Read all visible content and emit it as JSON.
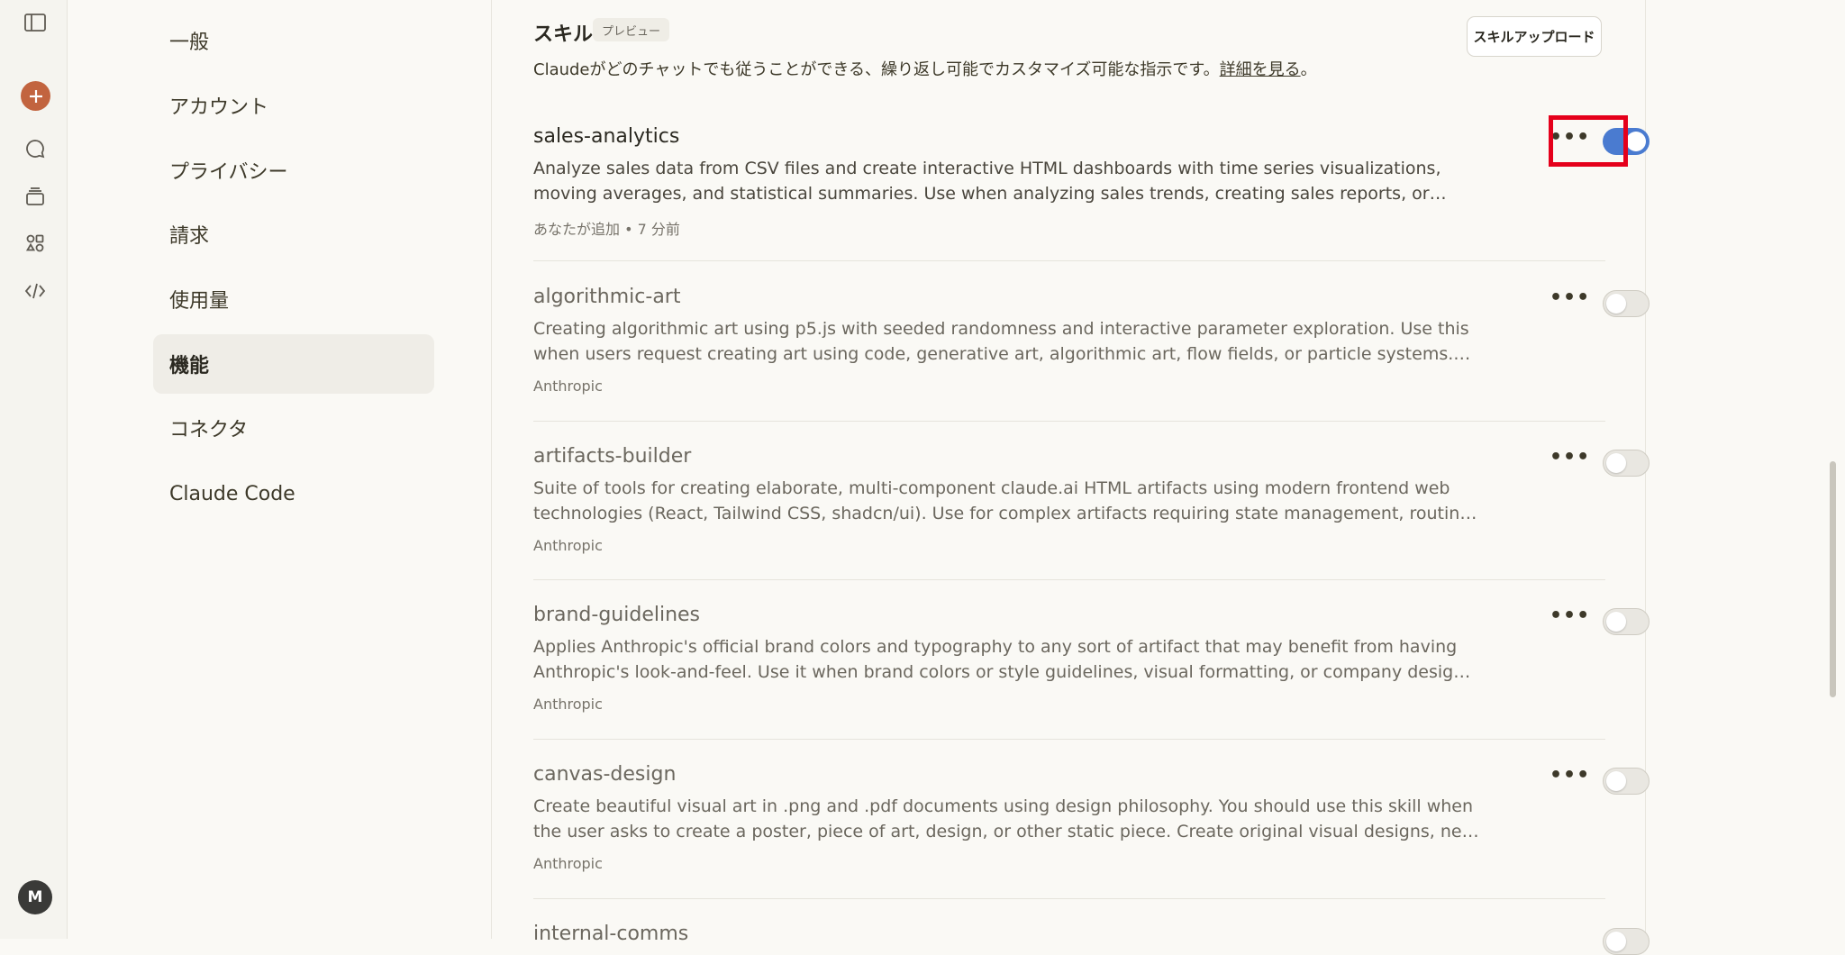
{
  "nav": {
    "items": [
      {
        "label": "一般"
      },
      {
        "label": "アカウント"
      },
      {
        "label": "プライバシー"
      },
      {
        "label": "請求"
      },
      {
        "label": "使用量"
      },
      {
        "label": "機能"
      },
      {
        "label": "コネクタ"
      },
      {
        "label": "Claude Code"
      }
    ],
    "active": "機能"
  },
  "rail": {
    "avatar_initial": "M"
  },
  "skills_section": {
    "title": "スキル",
    "badge": "プレビュー",
    "description": "Claudeがどのチャットでも従うことができる、繰り返し可能でカスタマイズ可能な指示です。",
    "link": "詳細を見る",
    "link_suffix": "。",
    "upload_label": "スキルアップロード"
  },
  "skills": [
    {
      "name": "sales-analytics",
      "line1": "Analyze sales data from CSV files and create interactive HTML dashboards with time series visualizations,",
      "line2": "moving averages, and statistical summaries. Use when analyzing sales trends, creating sales reports, or…",
      "meta": "あなたが追加 • 7 分前",
      "enabled": true
    },
    {
      "name": "algorithmic-art",
      "line1": "Creating algorithmic art using p5.js with seeded randomness and interactive parameter exploration. Use this",
      "line2": "when users request creating art using code, generative art, algorithmic art, flow fields, or particle systems.…",
      "meta": "Anthropic",
      "enabled": false
    },
    {
      "name": "artifacts-builder",
      "line1": "Suite of tools for creating elaborate, multi-component claude.ai HTML artifacts using modern frontend web",
      "line2": "technologies (React, Tailwind CSS, shadcn/ui). Use for complex artifacts requiring state management, routing, …",
      "meta": "Anthropic",
      "enabled": false
    },
    {
      "name": "brand-guidelines",
      "line1": "Applies Anthropic's official brand colors and typography to any sort of artifact that may benefit from having",
      "line2": "Anthropic's look-and-feel. Use it when brand colors or style guidelines, visual formatting, or company design…",
      "meta": "Anthropic",
      "enabled": false
    },
    {
      "name": "canvas-design",
      "line1": "Create beautiful visual art in .png and .pdf documents using design philosophy. You should use this skill when",
      "line2": "the user asks to create a poster, piece of art, design, or other static piece. Create original visual designs, never…",
      "meta": "Anthropic",
      "enabled": false
    },
    {
      "name": "internal-comms",
      "line1": "",
      "line2": "",
      "meta": "",
      "enabled": false
    }
  ],
  "colors": {
    "accent": "#4a7bd0",
    "brand": "#c2643f",
    "highlight": "#e5001b"
  }
}
